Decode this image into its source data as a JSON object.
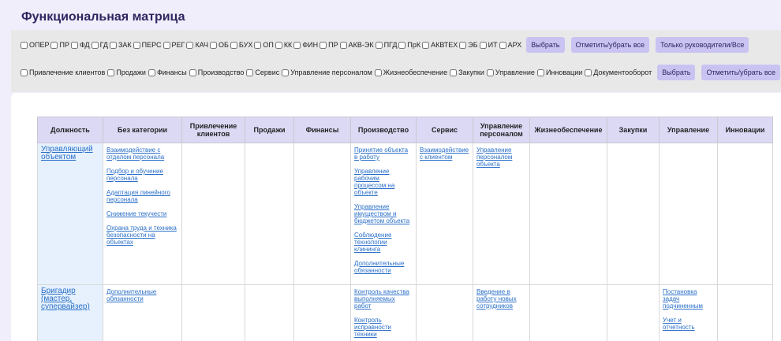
{
  "page_title": "Функциональная матрица",
  "filters": {
    "dept_checkboxes": [
      "ОПЕР",
      "ПР",
      "ФД",
      "ГД",
      "ЗАК",
      "ПЕРС",
      "РЕГ",
      "КАЧ",
      "ОБ",
      "БУХ",
      "ОП",
      "КК",
      "ФИН",
      "ПР",
      "АКВ-ЭК",
      "ПГД",
      "ПрК",
      "АКВТЕХ",
      "ЭБ",
      "ИТ",
      "АРХ"
    ],
    "row1_buttons": {
      "select": "Выбрать",
      "toggle_all": "Отметить/убрать все",
      "leaders_only": "Только руководители/Все"
    },
    "category_checkboxes": [
      "Привлечение клиентов",
      "Продажи",
      "Финансы",
      "Производство",
      "Сервис",
      "Управление персоналом",
      "Жизнеобеспечение",
      "Закупки",
      "Управление",
      "Инновации",
      "Документооборот"
    ],
    "row2_buttons": {
      "select": "Выбрать",
      "toggle_all": "Отметить/убрать все"
    }
  },
  "table": {
    "headers": [
      "Должность",
      "Без категории",
      "Привлечение клиентов",
      "Продажи",
      "Финансы",
      "Производство",
      "Сервис",
      "Управление персоналом",
      "Жизнеобеспечение",
      "Закупки",
      "Управление",
      "Инновации"
    ],
    "rows": [
      {
        "position": "Управляющий объектом",
        "cells": [
          [
            "Взаимодействие с отделом персонала",
            "Подбор и обучение персонала",
            "Адаптация линейного персонала",
            "Снижение текучести",
            "Охрана труда и техника безопасности на объектах"
          ],
          [],
          [],
          [],
          [
            "Принятие объекта в работу",
            "Управление рабочим процессом на объекте",
            "Управление имуществом и бюджетом объекта",
            "Соблюдение технологии клининга",
            "Дополнительные обязанности"
          ],
          [
            "Взаимодействие с клиентом"
          ],
          [
            "Управление персоналом объекта"
          ],
          [],
          [],
          [],
          []
        ]
      },
      {
        "position": "Бригадир (мастер, супервайзер)",
        "cells": [
          [
            "Дополнительные обязанности"
          ],
          [],
          [],
          [],
          [
            "Контроль качества выполняемых работ",
            "Контроль исправности техники"
          ],
          [],
          [
            "Введение в работу новых сотрудников"
          ],
          [],
          [],
          [
            "Постановка задач подчиненным",
            "Учет и отчетность"
          ],
          []
        ]
      }
    ]
  }
}
